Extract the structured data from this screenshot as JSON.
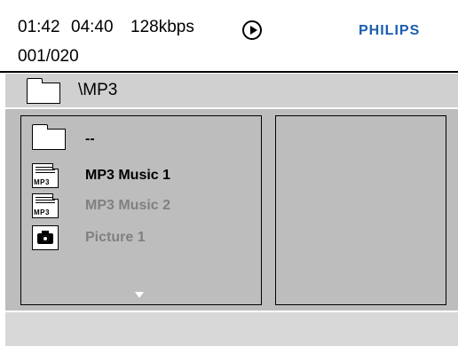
{
  "status": {
    "elapsed": "01:42",
    "total": "04:40",
    "bitrate": "128kbps",
    "play_state_icon": "play-circle-icon",
    "track": "001/020",
    "brand": "PHILIPS"
  },
  "path": {
    "icon": "folder-icon",
    "text": "\\MP3"
  },
  "file_list": {
    "items": [
      {
        "icon": "folder-icon",
        "label": "--"
      },
      {
        "icon": "mp3-file-icon",
        "label": "MP3 Music 1",
        "icon_text": "MP3"
      },
      {
        "icon": "mp3-file-icon",
        "label": "MP3 Music 2",
        "icon_text": "MP3"
      },
      {
        "icon": "picture-file-icon",
        "label": "Picture 1"
      }
    ],
    "scroll_indicator_icon": "scroll-down-arrow-icon"
  },
  "colors": {
    "brand": "#1a5eb0",
    "panel_bg": "#bdbdbd",
    "pathbar_bg": "#d0d0d0",
    "dimmed_text": "#808080"
  }
}
